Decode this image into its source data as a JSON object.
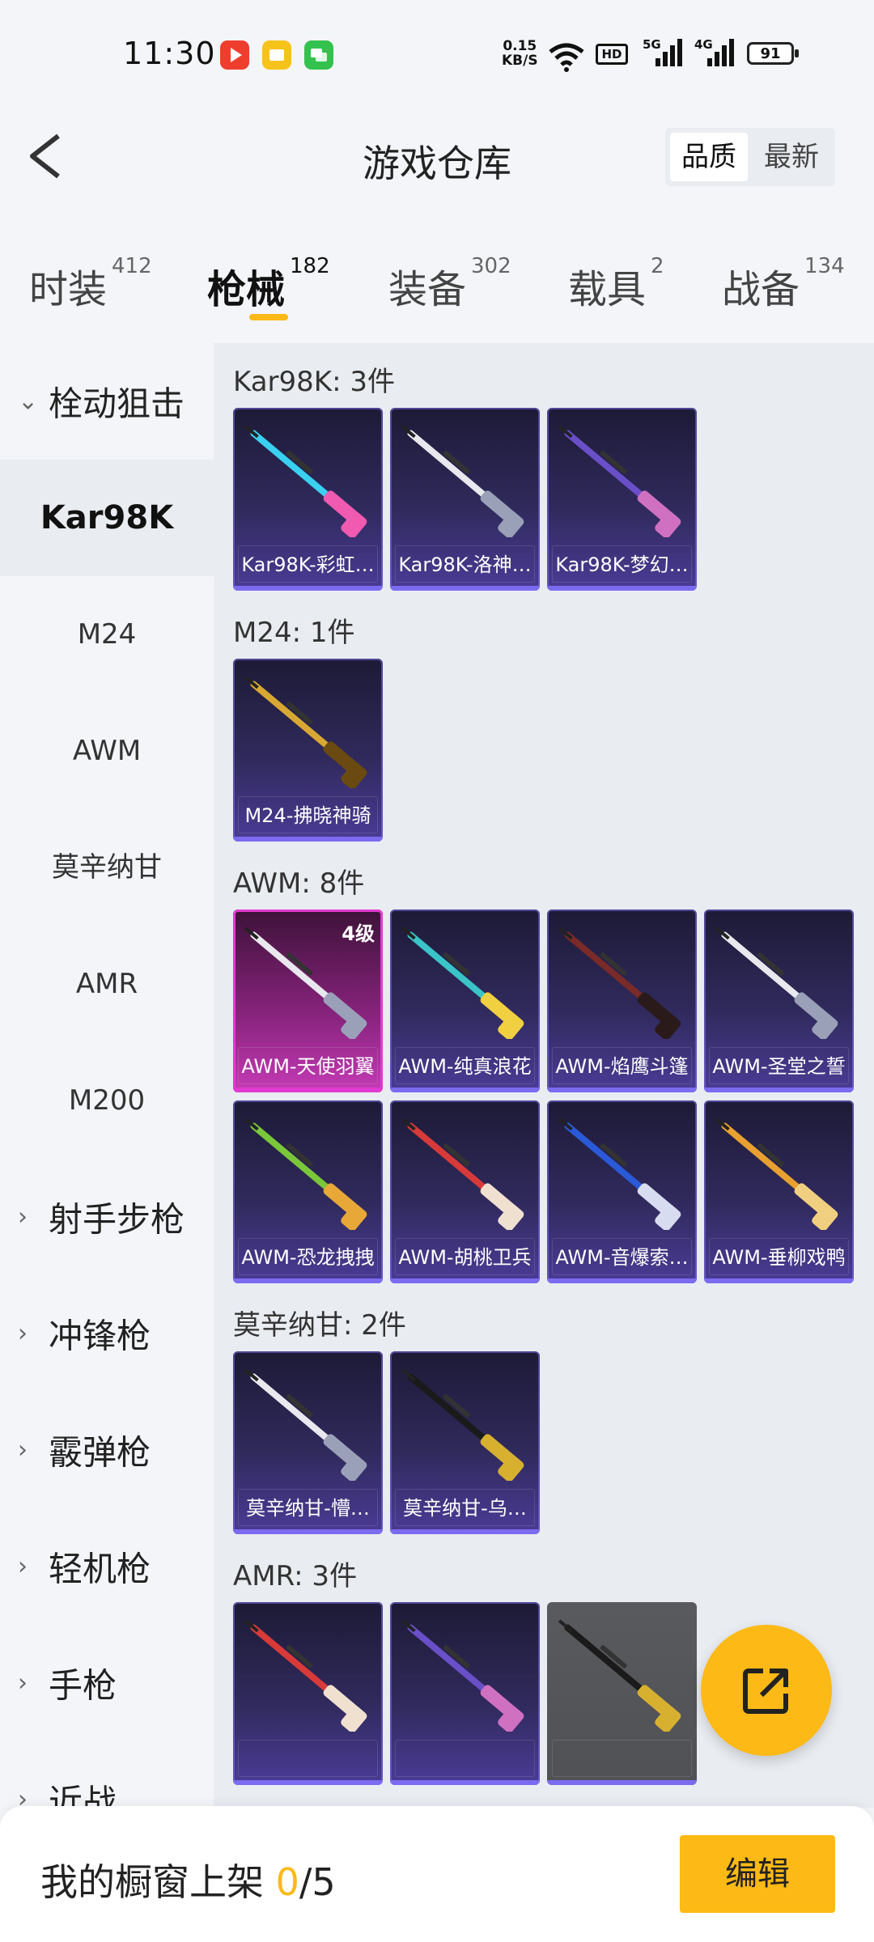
{
  "status_bar": {
    "time": "11:30",
    "net_speed_value": "0.15",
    "net_speed_unit": "KB/S",
    "hd_label": "HD",
    "signal1_label": "5G",
    "signal2_label": "4G",
    "battery": "91",
    "app_icons": [
      "video-app-icon",
      "files-app-icon",
      "chat-app-icon"
    ]
  },
  "header": {
    "title": "游戏仓库",
    "sort_options": [
      "品质",
      "最新"
    ],
    "active_sort": "品质"
  },
  "tabs": [
    {
      "label": "时装",
      "count": "412"
    },
    {
      "label": "枪械",
      "count": "182",
      "active": true
    },
    {
      "label": "装备",
      "count": "302"
    },
    {
      "label": "载具",
      "count": "2"
    },
    {
      "label": "战备",
      "count": "134"
    }
  ],
  "sidebar": {
    "group_open": "栓动狙击",
    "subitems": [
      "Kar98K",
      "M24",
      "AWM",
      "莫辛纳甘",
      "AMR",
      "M200"
    ],
    "active_subitem": "Kar98K",
    "groups": [
      "射手步枪",
      "冲锋枪",
      "霰弹枪",
      "轻机枪",
      "手枪",
      "近战"
    ]
  },
  "sections": [
    {
      "title": "Kar98K: 3件",
      "items": [
        {
          "name": "Kar98K-彩虹…",
          "gun": "cyan-pink"
        },
        {
          "name": "Kar98K-洛神…",
          "gun": "white"
        },
        {
          "name": "Kar98K-梦幻…",
          "gun": "purple"
        }
      ]
    },
    {
      "title": "M24: 1件",
      "items": [
        {
          "name": "M24-拂晓神骑",
          "gun": "gold"
        }
      ]
    },
    {
      "title": "AWM: 8件",
      "items": [
        {
          "name": "AWM-天使羽翼",
          "gun": "white",
          "level": "4级",
          "style": "pink"
        },
        {
          "name": "AWM-纯真浪花",
          "gun": "teal"
        },
        {
          "name": "AWM-焰鹰斗篷",
          "gun": "darkred"
        },
        {
          "name": "AWM-圣堂之誓",
          "gun": "white"
        },
        {
          "name": "AWM-恐龙拽拽",
          "gun": "green"
        },
        {
          "name": "AWM-胡桃卫兵",
          "gun": "red"
        },
        {
          "name": "AWM-音爆索…",
          "gun": "blue"
        },
        {
          "name": "AWM-垂柳戏鸭",
          "gun": "orange"
        }
      ]
    },
    {
      "title": "莫辛纳甘: 2件",
      "items": [
        {
          "name": "莫辛纳甘-懵…",
          "gun": "white"
        },
        {
          "name": "莫辛纳甘-乌…",
          "gun": "black-gold"
        }
      ]
    },
    {
      "title": "AMR: 3件",
      "items": [
        {
          "name": "",
          "gun": "red"
        },
        {
          "name": "",
          "gun": "purple"
        },
        {
          "name": "",
          "gun": "black-gold",
          "style": "grey"
        }
      ]
    }
  ],
  "fab": {
    "icon": "share-out-icon"
  },
  "bottom_bar": {
    "label_prefix": "我的橱窗上架 ",
    "shelf_count": "0",
    "shelf_total": "/5",
    "edit_label": "编辑"
  },
  "colors": {
    "accent": "#fdb915",
    "card_border": "#7b6bf0",
    "highlight_pink": "#e23ad0"
  }
}
